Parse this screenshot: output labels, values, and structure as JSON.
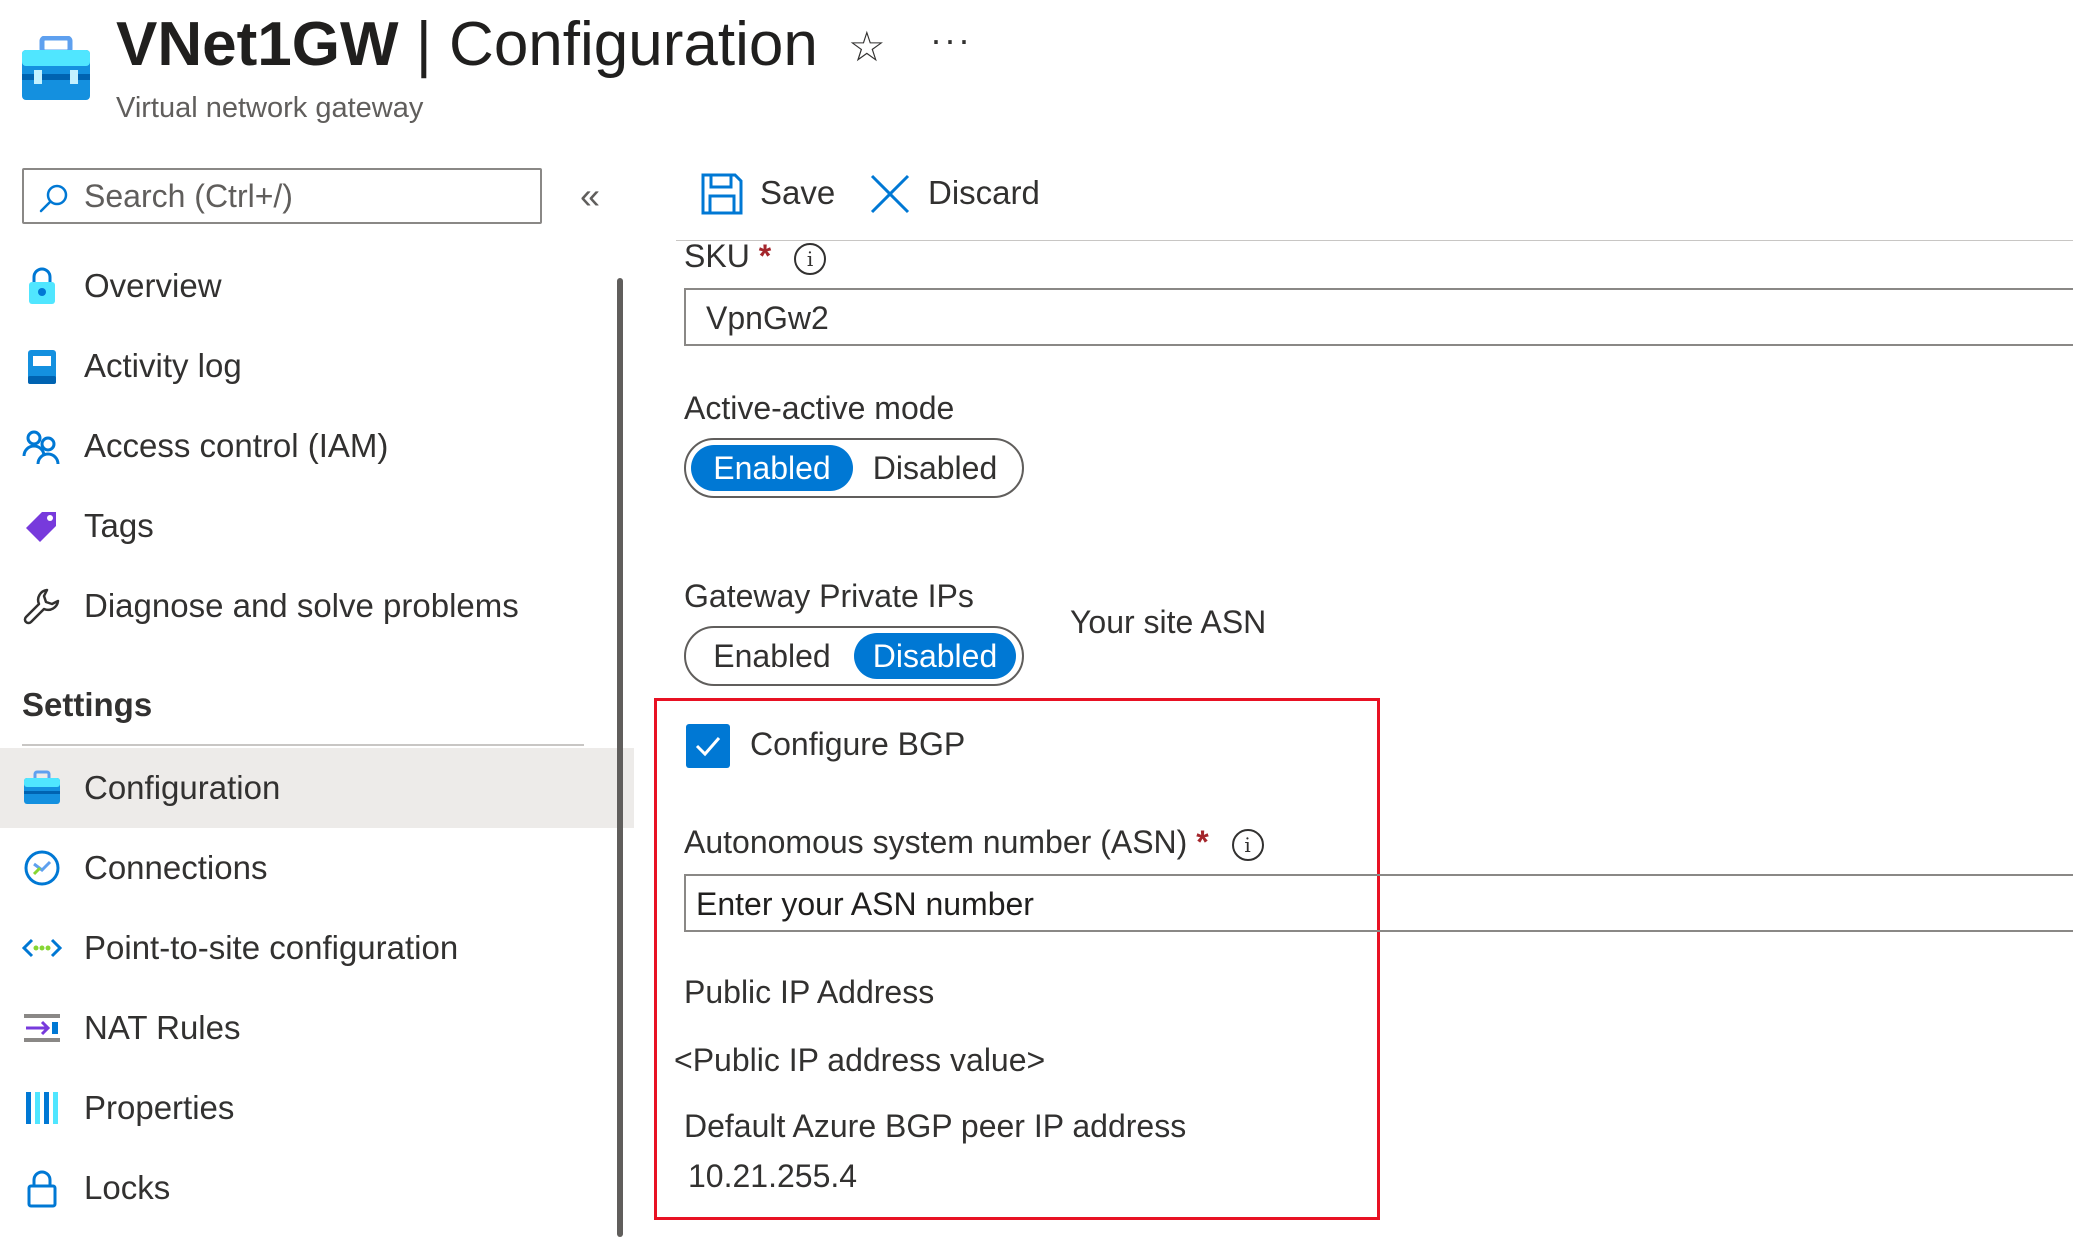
{
  "header": {
    "resource_name": "VNet1GW",
    "separator": " | ",
    "blade_name": "Configuration",
    "subtitle": "Virtual network gateway",
    "favorite_icon": "star-outline-icon",
    "more_icon": "ellipsis-icon"
  },
  "sidebar": {
    "search_placeholder": "Search (Ctrl+/)",
    "collapse_glyph": "«",
    "items": [
      {
        "label": "Overview",
        "icon": "overview-lock-icon"
      },
      {
        "label": "Activity log",
        "icon": "activity-log-icon"
      },
      {
        "label": "Access control (IAM)",
        "icon": "people-icon"
      },
      {
        "label": "Tags",
        "icon": "tag-icon"
      },
      {
        "label": "Diagnose and solve problems",
        "icon": "wrench-icon"
      }
    ],
    "settings_header": "Settings",
    "settings_items": [
      {
        "label": "Configuration",
        "icon": "toolbox-icon",
        "selected": true
      },
      {
        "label": "Connections",
        "icon": "connections-icon"
      },
      {
        "label": "Point-to-site configuration",
        "icon": "point-to-site-icon"
      },
      {
        "label": "NAT Rules",
        "icon": "nat-rules-icon"
      },
      {
        "label": "Properties",
        "icon": "properties-icon"
      },
      {
        "label": "Locks",
        "icon": "lock-icon"
      }
    ]
  },
  "toolbar": {
    "save_label": "Save",
    "discard_label": "Discard"
  },
  "form": {
    "sku": {
      "label": "SKU",
      "required_mark": "*",
      "value": "VpnGw2"
    },
    "active_active": {
      "label": "Active-active mode",
      "options": [
        "Enabled",
        "Disabled"
      ],
      "selected": "Enabled"
    },
    "gateway_private_ips": {
      "label": "Gateway Private IPs",
      "options": [
        "Enabled",
        "Disabled"
      ],
      "selected": "Disabled"
    },
    "site_asn_note": "Your site ASN",
    "configure_bgp": {
      "label": "Configure BGP",
      "checked": true
    },
    "asn": {
      "label": "Autonomous system number (ASN)",
      "required_mark": "*",
      "placeholder": "Enter your ASN number"
    },
    "public_ip": {
      "label": "Public IP Address",
      "value": "<Public IP address value>"
    },
    "bgp_peer": {
      "label": "Default Azure BGP peer IP address",
      "value": "10.21.255.4"
    }
  },
  "colors": {
    "accent": "#0078d4",
    "highlight_border": "#e81123",
    "required": "#a4262c"
  }
}
